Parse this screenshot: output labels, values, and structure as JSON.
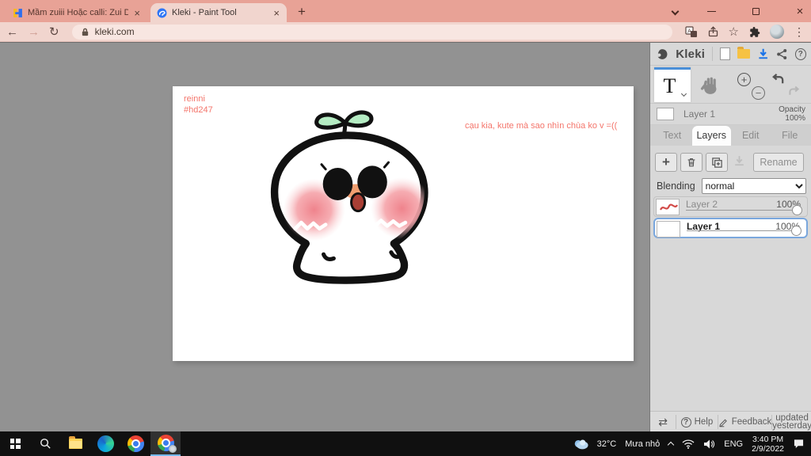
{
  "browser": {
    "tab1_title": "Mầm zuiii Hoặc calli: Zui Digi :) C",
    "tab2_title": "Kleki - Paint Tool",
    "url": "kleki.com"
  },
  "canvas": {
    "signature_line1": "reinni",
    "signature_line2": "#hd247",
    "caption": "cạu kia, kute mà sao nhìn chùa ko v =(("
  },
  "sidebar": {
    "brand": "Kleki",
    "active_layer_name": "Layer 1",
    "opacity_label": "Opacity",
    "opacity_value": "100%",
    "tabs": [
      "Text",
      "Layers",
      "Edit",
      "File"
    ],
    "rename_label": "Rename",
    "blending_label": "Blending",
    "blending_value": "normal",
    "layers": [
      {
        "name": "Layer 2",
        "opacity": "100%"
      },
      {
        "name": "Layer 1",
        "opacity": "100%"
      }
    ],
    "help_label": "Help",
    "feedback_label": "Feedback",
    "updated_line1": "updated",
    "updated_line2": "yesterday"
  },
  "taskbar": {
    "weather_temp": "32°C",
    "weather_desc": "Mưa nhỏ",
    "language_label": "ENG",
    "time": "3:40 PM",
    "date": "2/9/2022"
  },
  "theme": {
    "tabbar_bg": "#e8a296",
    "toolbar_bg": "#f1d5ce",
    "workspace_bg": "#929292",
    "sidebar_bg": "#d8d8d8",
    "canvas_text_color": "#f4756b",
    "selection_blue": "#7aa7dd",
    "taskbar_bg": "#101010"
  }
}
